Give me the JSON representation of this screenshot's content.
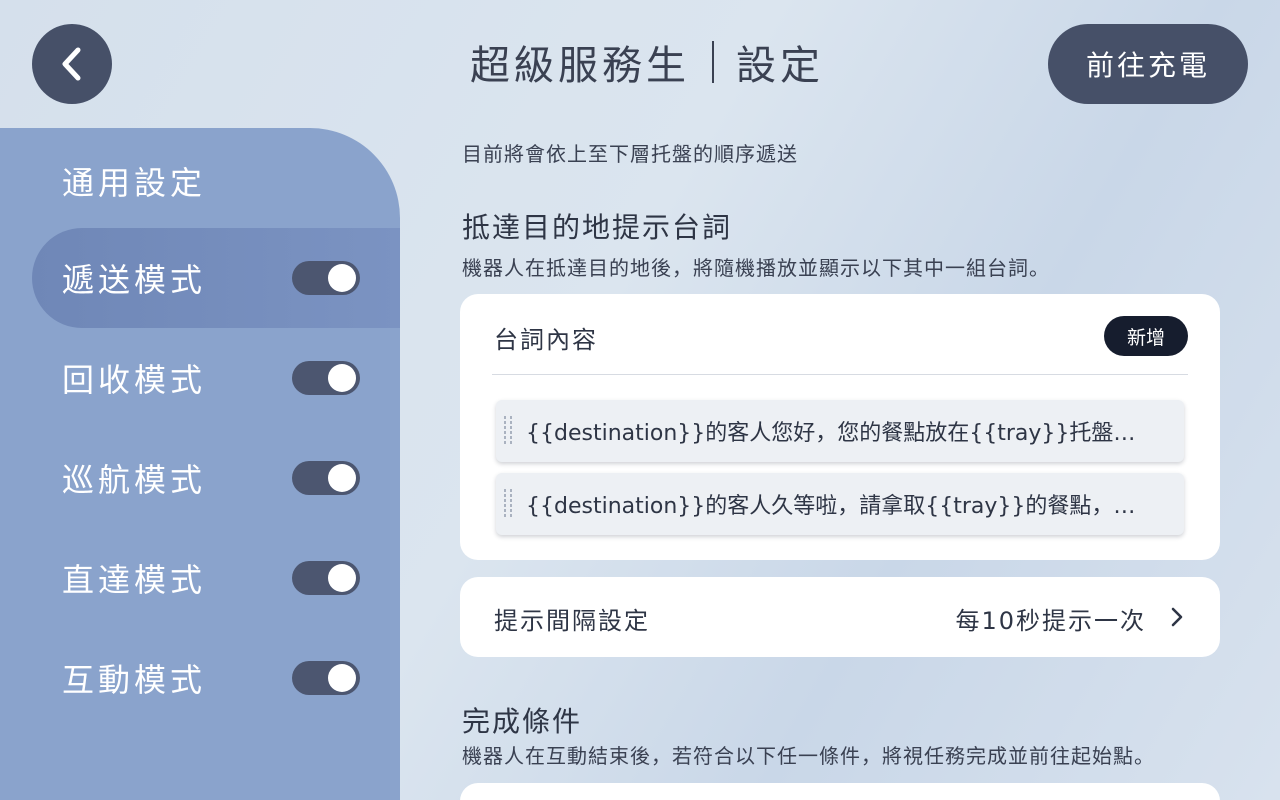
{
  "header": {
    "title": "超級服務生",
    "subtitle": "設定",
    "charge_label": "前往充電"
  },
  "sidebar": {
    "general_label": "通用設定",
    "items": [
      {
        "label": "遞送模式",
        "enabled": true,
        "active": true
      },
      {
        "label": "回收模式",
        "enabled": true,
        "active": false
      },
      {
        "label": "巡航模式",
        "enabled": true,
        "active": false
      },
      {
        "label": "直達模式",
        "enabled": true,
        "active": false
      },
      {
        "label": "互動模式",
        "enabled": true,
        "active": false
      }
    ]
  },
  "main": {
    "order_note": "目前將會依上至下層托盤的順序遞送",
    "arrival": {
      "title": "抵達目的地提示台詞",
      "description": "機器人在抵達目的地後，將隨機播放並顯示以下其中一組台詞。",
      "list_header": "台詞內容",
      "add_label": "新增",
      "lines": [
        "{{destination}}的客人您好，您的餐點放在{{tray}}托盤，取…",
        "{{destination}}的客人久等啦，請拿取{{tray}}的餐點，取餐…"
      ]
    },
    "interval": {
      "label": "提示間隔設定",
      "value": "每10秒提示一次"
    },
    "completion": {
      "title": "完成條件",
      "description": "機器人在互動結束後，若符合以下任一條件，將視任務完成並前往起始點。"
    }
  },
  "colors": {
    "dark_button": "#465068",
    "sidebar": "#8aa3cc",
    "sidebar_active": "#7b93c2",
    "toggle_on": "#4c5670",
    "add_button": "#161d2e"
  },
  "icons": {
    "back": "chevron-left-icon",
    "interval": "chevron-right-icon",
    "drag": "drag-handle-icon"
  }
}
